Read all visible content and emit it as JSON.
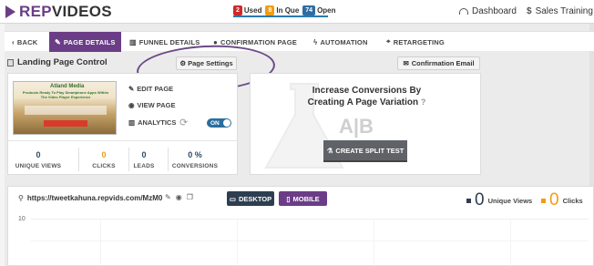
{
  "brand": {
    "prefix": "REP",
    "suffix": "VIDEOS"
  },
  "stats": [
    {
      "count": "2",
      "label": "Used",
      "color": "#cc2a2a"
    },
    {
      "count": "8",
      "label": "In Que",
      "color": "#f39c12"
    },
    {
      "count": "74",
      "label": "Open",
      "color": "#2e6da4"
    }
  ],
  "header": {
    "dashboard": "Dashboard",
    "training": "Sales Training"
  },
  "tabs": {
    "back": "BACK",
    "page_details": "PAGE DETAILS",
    "funnel_details": "FUNNEL DETAILS",
    "confirmation_page": "CONFIRMATION PAGE",
    "automation": "AUTOMATION",
    "retargeting": "RETARGETING"
  },
  "landing": {
    "title": "Landing Page Control",
    "page_settings": "Page Settings",
    "confirmation_email": "Confirmation Email",
    "edit_page": "EDIT PAGE",
    "view_page": "VIEW PAGE",
    "analytics": "ANALYTICS",
    "toggle": "ON",
    "thumb_logo": "Atland Media",
    "thumb_headline": "Products Ready To Play Smartphone Apps Within The Video Player Experience"
  },
  "metrics": [
    {
      "value": "0",
      "label": "UNIQUE VIEWS"
    },
    {
      "value": "0",
      "label": "CLICKS"
    },
    {
      "value": "0",
      "label": "LEADS"
    },
    {
      "value": "0 %",
      "label": "CONVERSIONS"
    }
  ],
  "split": {
    "heading_line1": "Increase Conversions By",
    "heading_line2": "Creating A Page Variation",
    "ab": "A|B",
    "button": "CREATE SPLIT TEST"
  },
  "bottom": {
    "url": "https://tweetkahuna.repvids.com/MzM0",
    "desktop": "DESKTOP",
    "mobile": "MOBILE",
    "unique_views_value": "0",
    "unique_views_label": "Unique Views",
    "clicks_value": "0",
    "clicks_label": "Clicks",
    "ytick": "10"
  },
  "colors": {
    "brand_purple": "#6b3d87",
    "navy": "#2d3e50",
    "orange": "#f39c12"
  }
}
